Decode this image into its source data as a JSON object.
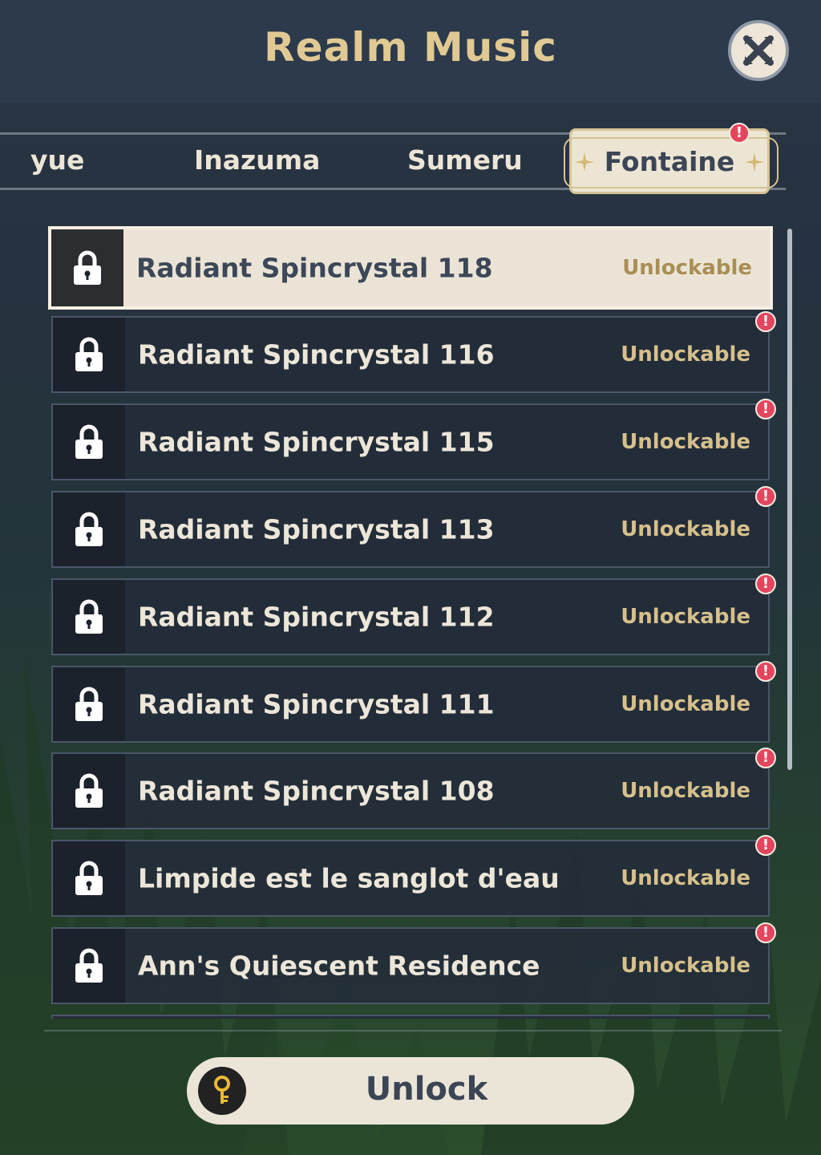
{
  "header": {
    "title": "Realm Music"
  },
  "tabs": [
    {
      "label": "Liyue",
      "visible_label": "yue"
    },
    {
      "label": "Inazuma"
    },
    {
      "label": "Sumeru"
    },
    {
      "label": "Fontaine",
      "active": true,
      "badge": "!"
    }
  ],
  "list": {
    "items": [
      {
        "title": "Radiant Spincrystal 118",
        "status": "Unlockable",
        "selected": true,
        "badge": ""
      },
      {
        "title": "Radiant Spincrystal 116",
        "status": "Unlockable",
        "badge": "!"
      },
      {
        "title": "Radiant Spincrystal 115",
        "status": "Unlockable",
        "badge": "!"
      },
      {
        "title": "Radiant Spincrystal 113",
        "status": "Unlockable",
        "badge": "!"
      },
      {
        "title": "Radiant Spincrystal 112",
        "status": "Unlockable",
        "badge": "!"
      },
      {
        "title": "Radiant Spincrystal 111",
        "status": "Unlockable",
        "badge": "!"
      },
      {
        "title": "Radiant Spincrystal 108",
        "status": "Unlockable",
        "badge": "!"
      },
      {
        "title": "Limpide est le sanglot d'eau",
        "status": "Unlockable",
        "badge": "!"
      },
      {
        "title": "Ann's Quiescent Residence",
        "status": "Unlockable",
        "badge": "!"
      }
    ]
  },
  "footer": {
    "unlock_label": "Unlock",
    "key_icon": "key-icon"
  },
  "colors": {
    "accent_gold": "#e0c993",
    "badge_red": "#e4455d",
    "panel_dark": "#242c3a",
    "cream": "#ebe5d8"
  }
}
